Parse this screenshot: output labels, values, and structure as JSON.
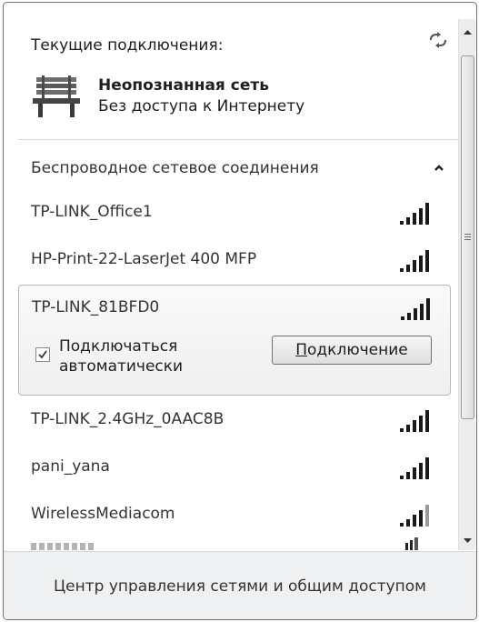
{
  "header": {
    "title": "Текущие подключения:",
    "network_name": "Неопознанная сеть",
    "network_status": "Без доступа к Интернету",
    "refresh_icon": "refresh-icon",
    "network_icon": "bench-network-icon"
  },
  "wireless": {
    "section_title": "Беспроводное сетевое соединения",
    "collapse_icon": "chevron-up-icon",
    "networks": [
      {
        "ssid": "TP-LINK_Office1",
        "signal": 5
      },
      {
        "ssid": "HP-Print-22-LaserJet 400 MFP",
        "signal": 5
      },
      {
        "ssid": "TP-LINK_81BFD0",
        "signal": 5
      },
      {
        "ssid": "TP-LINK_2.4GHz_0AAC8B",
        "signal": 5
      },
      {
        "ssid": "pani_yana",
        "signal": 5
      },
      {
        "ssid": "WirelessMediacom",
        "signal": 4
      }
    ],
    "selected": {
      "auto_connect_label": "Подключаться автоматически",
      "auto_connect_checked": true,
      "connect_button_underlined": "П",
      "connect_button_rest": "одключение"
    }
  },
  "footer": {
    "link": "Центр управления сетями и общим доступом"
  },
  "colors": {
    "text": "#1e1e1e",
    "secondary_text": "#333333",
    "selection_border": "#b6b6b6",
    "footer_bg": "#eef0f2",
    "signal_bar": "#1a1a1a"
  }
}
